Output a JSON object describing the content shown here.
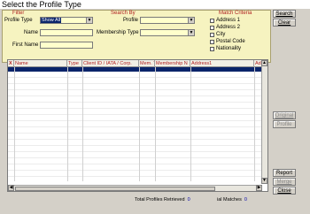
{
  "caption": "Select the Profile Type",
  "filter": {
    "legend": "Filter",
    "profile_type_label": "Profile Type",
    "profile_type_value": "Show All",
    "name_label": "Name",
    "first_name_label": "First Name"
  },
  "search_by": {
    "legend": "Search By",
    "profile_label": "Profile",
    "membership_type_label": "Membership Type"
  },
  "match_criteria": {
    "legend": "Match Criteria",
    "options": [
      "Address 1",
      "Address 2",
      "City",
      "Postal Code",
      "Nationality"
    ]
  },
  "grid": {
    "columns": [
      "X",
      "Name",
      "Type",
      "Client ID / IATA / Corp.",
      "Mem. Type",
      "Membership N",
      "Address1",
      "Address"
    ]
  },
  "buttons": {
    "search": "Search",
    "clear": "Clear",
    "original": "Original",
    "profile": "Profile",
    "report": "Report",
    "merge": "Merge",
    "close": "Close"
  },
  "footer": {
    "total_label": "Total Profiles Retrieved",
    "total_value": "0",
    "matches_label": "ial Matches",
    "matches_value": "0"
  },
  "icons": {
    "dropdown": "chevron-down-icon",
    "scroll_up": "arrow-up-icon",
    "scroll_down": "arrow-down-icon",
    "scroll_left": "arrow-left-icon",
    "scroll_right": "arrow-right-icon"
  }
}
